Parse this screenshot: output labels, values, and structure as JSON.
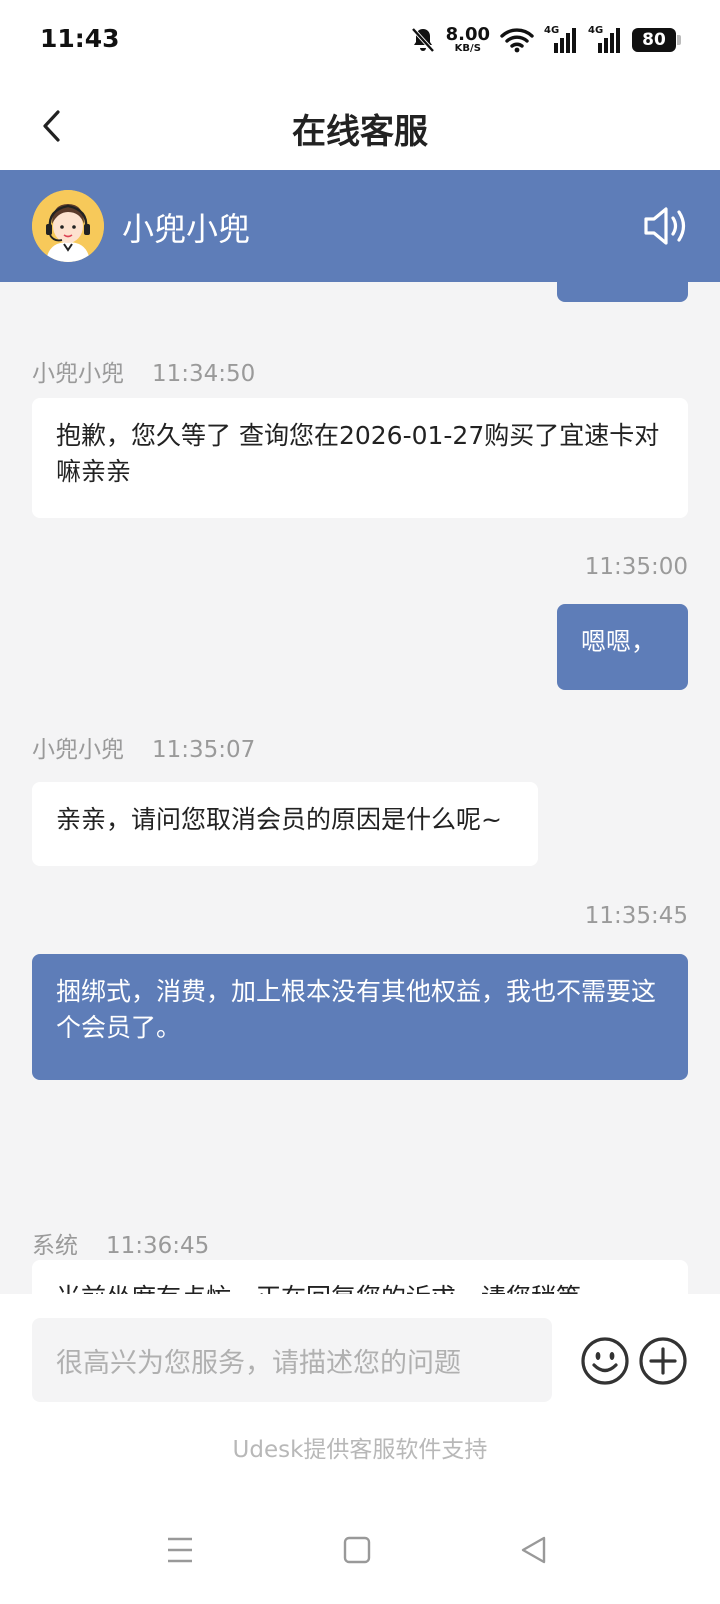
{
  "status_bar": {
    "time": "11:43",
    "net_speed": "8.00",
    "net_unit": "KB/S",
    "signal1_tag": "4G",
    "signal2_tag": "4G",
    "battery": "80"
  },
  "nav": {
    "title": "在线客服"
  },
  "agent": {
    "name": "小兜小兜"
  },
  "messages": [
    {
      "from": "agent",
      "sender": "小兜小兜",
      "time": "11:34:50",
      "text": "抱歉，您久等了 查询您在2026-01-27购买了宜速卡对嘛亲亲"
    },
    {
      "from": "user",
      "time": "11:35:00",
      "text": "嗯嗯，"
    },
    {
      "from": "agent",
      "sender": "小兜小兜",
      "time": "11:35:07",
      "text": "亲亲，请问您取消会员的原因是什么呢~"
    },
    {
      "from": "user",
      "time": "11:35:45",
      "text": "捆绑式，消费，加上根本没有其他权益，我也不需要这个会员了。"
    },
    {
      "from": "system",
      "sender": "系统",
      "time": "11:36:45",
      "text": "当前坐席有点忙，正在回复您的诉求，请您稍等"
    }
  ],
  "input": {
    "placeholder": "很高兴为您服务，请描述您的问题"
  },
  "footer": {
    "powered_by": "Udesk提供客服软件支持"
  },
  "colors": {
    "accent": "#5e7db8",
    "chat_bg": "#f4f4f5"
  }
}
